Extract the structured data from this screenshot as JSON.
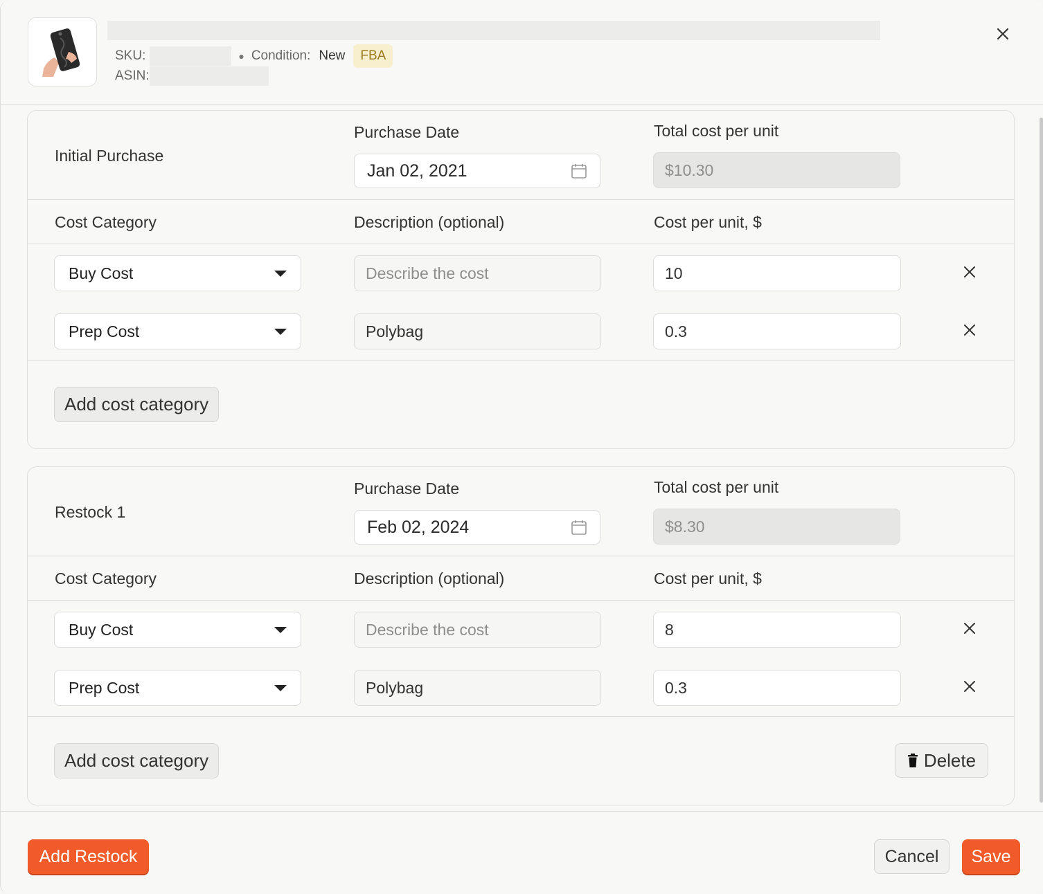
{
  "header": {
    "sku_label": "SKU:",
    "condition_label": "Condition:",
    "condition_value": "New",
    "fulfillment_badge": "FBA",
    "asin_label": "ASIN:"
  },
  "purchases": [
    {
      "title": "Initial Purchase",
      "purchase_date_label": "Purchase Date",
      "purchase_date": "Jan 02, 2021",
      "total_label": "Total cost per unit",
      "total_cost": "$10.30",
      "columns": [
        "Cost Category",
        "Description (optional)",
        "Cost per unit, $"
      ],
      "rows": [
        {
          "category": "Buy Cost",
          "description": "",
          "description_placeholder": "Describe the cost",
          "cost": "10"
        },
        {
          "category": "Prep Cost",
          "description": "Polybag",
          "description_placeholder": "Describe the cost",
          "cost": "0.3"
        }
      ],
      "add_label": "Add cost category"
    },
    {
      "title": "Restock 1",
      "purchase_date_label": "Purchase Date",
      "purchase_date": "Feb 02, 2024",
      "total_label": "Total cost per unit",
      "total_cost": "$8.30",
      "columns": [
        "Cost Category",
        "Description (optional)",
        "Cost per unit, $"
      ],
      "rows": [
        {
          "category": "Buy Cost",
          "description": "",
          "description_placeholder": "Describe the cost",
          "cost": "8"
        },
        {
          "category": "Prep Cost",
          "description": "Polybag",
          "description_placeholder": "Describe the cost",
          "cost": "0.3"
        }
      ],
      "add_label": "Add cost category",
      "delete_label": "Delete"
    }
  ],
  "footer": {
    "add_restock_label": "Add Restock",
    "cancel_label": "Cancel",
    "save_label": "Save"
  },
  "colors": {
    "accent": "#f15a29",
    "badge_bg": "#f8efcf",
    "badge_text": "#9a7a1b"
  }
}
